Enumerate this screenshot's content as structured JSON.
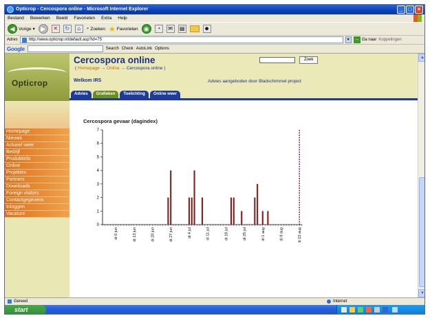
{
  "browser": {
    "title": "Opticrop - Cercospora online - Microsoft Internet Explorer",
    "menu": [
      "Bestand",
      "Bewerken",
      "Beeld",
      "Favorieten",
      "Extra",
      "Help"
    ],
    "toolbar": {
      "back": "Vorige",
      "search": "Zoeken",
      "favorites": "Favorieten"
    },
    "address": {
      "label": "Adres",
      "url": "http://www.opticrop.nl/default.asp?id=75",
      "go": "Ga naar",
      "links": "Koppelingen"
    },
    "google": {
      "logo": "Google",
      "search": "Search",
      "check": "Check",
      "autolink": "AutoLink",
      "options": "Options"
    },
    "status": {
      "left": "Gereed",
      "zone": "Internet"
    }
  },
  "site": {
    "logo": "Opticrop",
    "title": "Cercospora online",
    "breadcrumb": {
      "open": "(",
      "home": "Homepage",
      "sep1": "→",
      "online": "Online",
      "sep2": "→",
      "current": "Cercospora online",
      "close": ")"
    },
    "welcome": "Welkom IRS",
    "advies": "Advies aangeboden door Bladschimmel project",
    "search_button": "Zoek",
    "tabs": [
      "Advies",
      "Grafieken",
      "Toelichting",
      "Online weer"
    ],
    "nav": [
      "Homepage",
      "Nieuws",
      "Actueel weer",
      "Bedrijf",
      "Produktinfo",
      "Online",
      "Projekten",
      "Partners",
      "Downloads",
      "Foreign visitors",
      "Contactgegevens",
      "Inloggen",
      "Vacature"
    ]
  },
  "chart_title": "Cercospora gevaar (dagindex)",
  "chart_data": {
    "type": "bar",
    "title": "Cercospora gevaar (dagindex)",
    "ylim": [
      0,
      7
    ],
    "yticks": [
      "0",
      "1",
      "2",
      "3",
      "4",
      "5",
      "6",
      "7"
    ],
    "xticks": [
      "di 6 jun",
      "di 13 jun",
      "di 20 jun",
      "di 27 jun",
      "di 4 jul",
      "di 11 jul",
      "di 18 jul",
      "di 25 jul",
      "di 1 aug",
      "di 8 aug",
      "di 15 aug"
    ],
    "x_start": "2006-06-01",
    "x_end": "2006-08-16",
    "bars": [
      {
        "date": "2006-06-26",
        "value": 2
      },
      {
        "date": "2006-06-27",
        "value": 4
      },
      {
        "date": "2006-07-04",
        "value": 2
      },
      {
        "date": "2006-07-05",
        "value": 2
      },
      {
        "date": "2006-07-06",
        "value": 4
      },
      {
        "date": "2006-07-09",
        "value": 2
      },
      {
        "date": "2006-07-20",
        "value": 2
      },
      {
        "date": "2006-07-21",
        "value": 2
      },
      {
        "date": "2006-07-24",
        "value": 1
      },
      {
        "date": "2006-07-29",
        "value": 2
      },
      {
        "date": "2006-07-30",
        "value": 3
      },
      {
        "date": "2006-08-01",
        "value": 1
      },
      {
        "date": "2006-08-03",
        "value": 1
      }
    ],
    "marker_date": "2006-08-15",
    "bar_color": "#8b1a1a",
    "marker_color": "#8b1a4a"
  },
  "colors": {
    "nav_orange": "#e0701a",
    "site_blue": "#1b2f86",
    "tab_blue": "#1e3a9a",
    "tab_green": "#6a8c20"
  }
}
